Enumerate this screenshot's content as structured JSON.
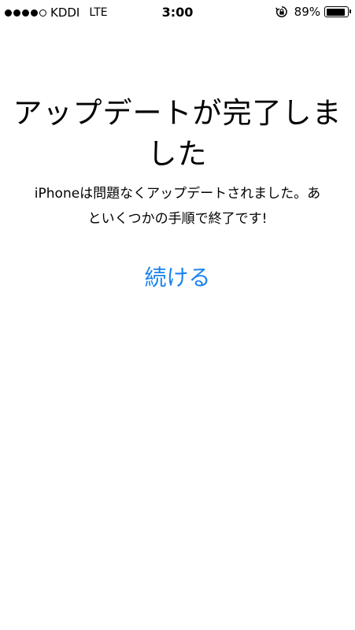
{
  "status_bar": {
    "signal_bars_filled": 4,
    "signal_bars_total": 5,
    "carrier": "KDDI",
    "network": "LTE",
    "time": "3:00",
    "battery_percent": "89%",
    "battery_level": 0.89,
    "orientation_lock_icon": "rotation-lock-icon"
  },
  "main": {
    "title": "アップデートが完了しました",
    "message": "iPhoneは問題なくアップデートされました。あといくつかの手順で終了です!",
    "continue_label": "続ける"
  },
  "colors": {
    "accent": "#1a82f0",
    "text": "#000000",
    "background": "#ffffff"
  }
}
